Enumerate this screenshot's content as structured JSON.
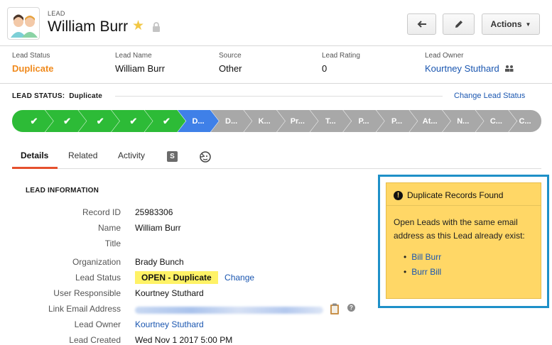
{
  "header": {
    "object_type": "LEAD",
    "record_name": "William Burr",
    "actions_label": "Actions"
  },
  "highlights": [
    {
      "label": "Lead Status",
      "value": "Duplicate"
    },
    {
      "label": "Lead Name",
      "value": "William Burr"
    },
    {
      "label": "Source",
      "value": "Other"
    },
    {
      "label": "Lead Rating",
      "value": "0"
    },
    {
      "label": "Lead Owner",
      "value": "Kourtney Stuthard"
    }
  ],
  "status_bar": {
    "title": "LEAD STATUS:",
    "current": "Duplicate",
    "change_link": "Change Lead Status",
    "steps": [
      "✔",
      "✔",
      "✔",
      "✔",
      "✔",
      "D...",
      "D...",
      "K...",
      "Pr...",
      "T...",
      "P...",
      "P...",
      "At...",
      "N...",
      "C...",
      "C..."
    ],
    "completed_count": 5,
    "current_index": 5
  },
  "tabs": {
    "details": "Details",
    "related": "Related",
    "activity": "Activity",
    "s_label": "S"
  },
  "lead_info": {
    "section_title": "LEAD INFORMATION",
    "fields": [
      {
        "label": "Record ID",
        "value": "25983306"
      },
      {
        "label": "Name",
        "value": "William Burr"
      },
      {
        "label": "Title",
        "value": ""
      },
      {
        "label": "Organization",
        "value": "Brady Bunch"
      },
      {
        "label": "Lead Status",
        "value": "OPEN - Duplicate",
        "action": "Change"
      },
      {
        "label": "User Responsible",
        "value": "Kourtney Stuthard"
      },
      {
        "label": "Link Email Address",
        "value": ""
      },
      {
        "label": "Lead Owner",
        "value": "Kourtney Stuthard"
      },
      {
        "label": "Lead Created",
        "value": "Wed Nov 1 2017 5:00 PM"
      }
    ]
  },
  "duplicates": {
    "title": "Duplicate Records Found",
    "message": "Open Leads with the same email address as this Lead already exist:",
    "records": [
      "Bill Burr",
      "Burr Bill"
    ]
  },
  "colors": {
    "complete": "#2dbb37",
    "current": "#3f80e8",
    "pending": "#a8a8a8",
    "status_orange": "#f08a1d",
    "link": "#1a56b0",
    "alert_bg": "#ffd766",
    "highlight_frame": "#1e90c8"
  }
}
